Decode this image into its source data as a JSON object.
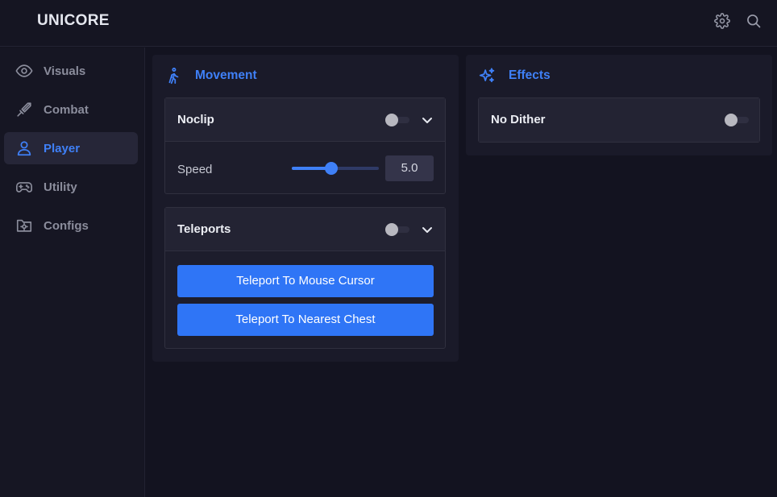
{
  "app": {
    "title": "UNICORE"
  },
  "topbar": {
    "icons": [
      "gear-icon",
      "search-icon"
    ]
  },
  "sidebar": {
    "items": [
      {
        "label": "Visuals",
        "icon": "eye-icon",
        "active": false
      },
      {
        "label": "Combat",
        "icon": "sword-icon",
        "active": false
      },
      {
        "label": "Player",
        "icon": "user-icon",
        "active": true
      },
      {
        "label": "Utility",
        "icon": "gamepad-icon",
        "active": false
      },
      {
        "label": "Configs",
        "icon": "folder-gear-icon",
        "active": false
      }
    ]
  },
  "sections": {
    "movement": {
      "title": "Movement",
      "icon": "walking-person-icon",
      "modules": {
        "noclip": {
          "name": "Noclip",
          "enabled": false,
          "settings": {
            "speed": {
              "label": "Speed",
              "value": "5.0",
              "fraction": 0.45
            }
          }
        },
        "teleports": {
          "name": "Teleports",
          "enabled": false,
          "buttons": [
            "Teleport To Mouse Cursor",
            "Teleport To Nearest Chest"
          ]
        }
      }
    },
    "effects": {
      "title": "Effects",
      "icon": "sparkles-icon",
      "modules": {
        "no_dither": {
          "name": "No Dither",
          "enabled": false
        }
      }
    }
  },
  "colors": {
    "accent": "#3f80f7",
    "background": "#131320",
    "panel": "#1a1a29",
    "module_header": "#232333",
    "muted_text": "#8b8d9c"
  }
}
